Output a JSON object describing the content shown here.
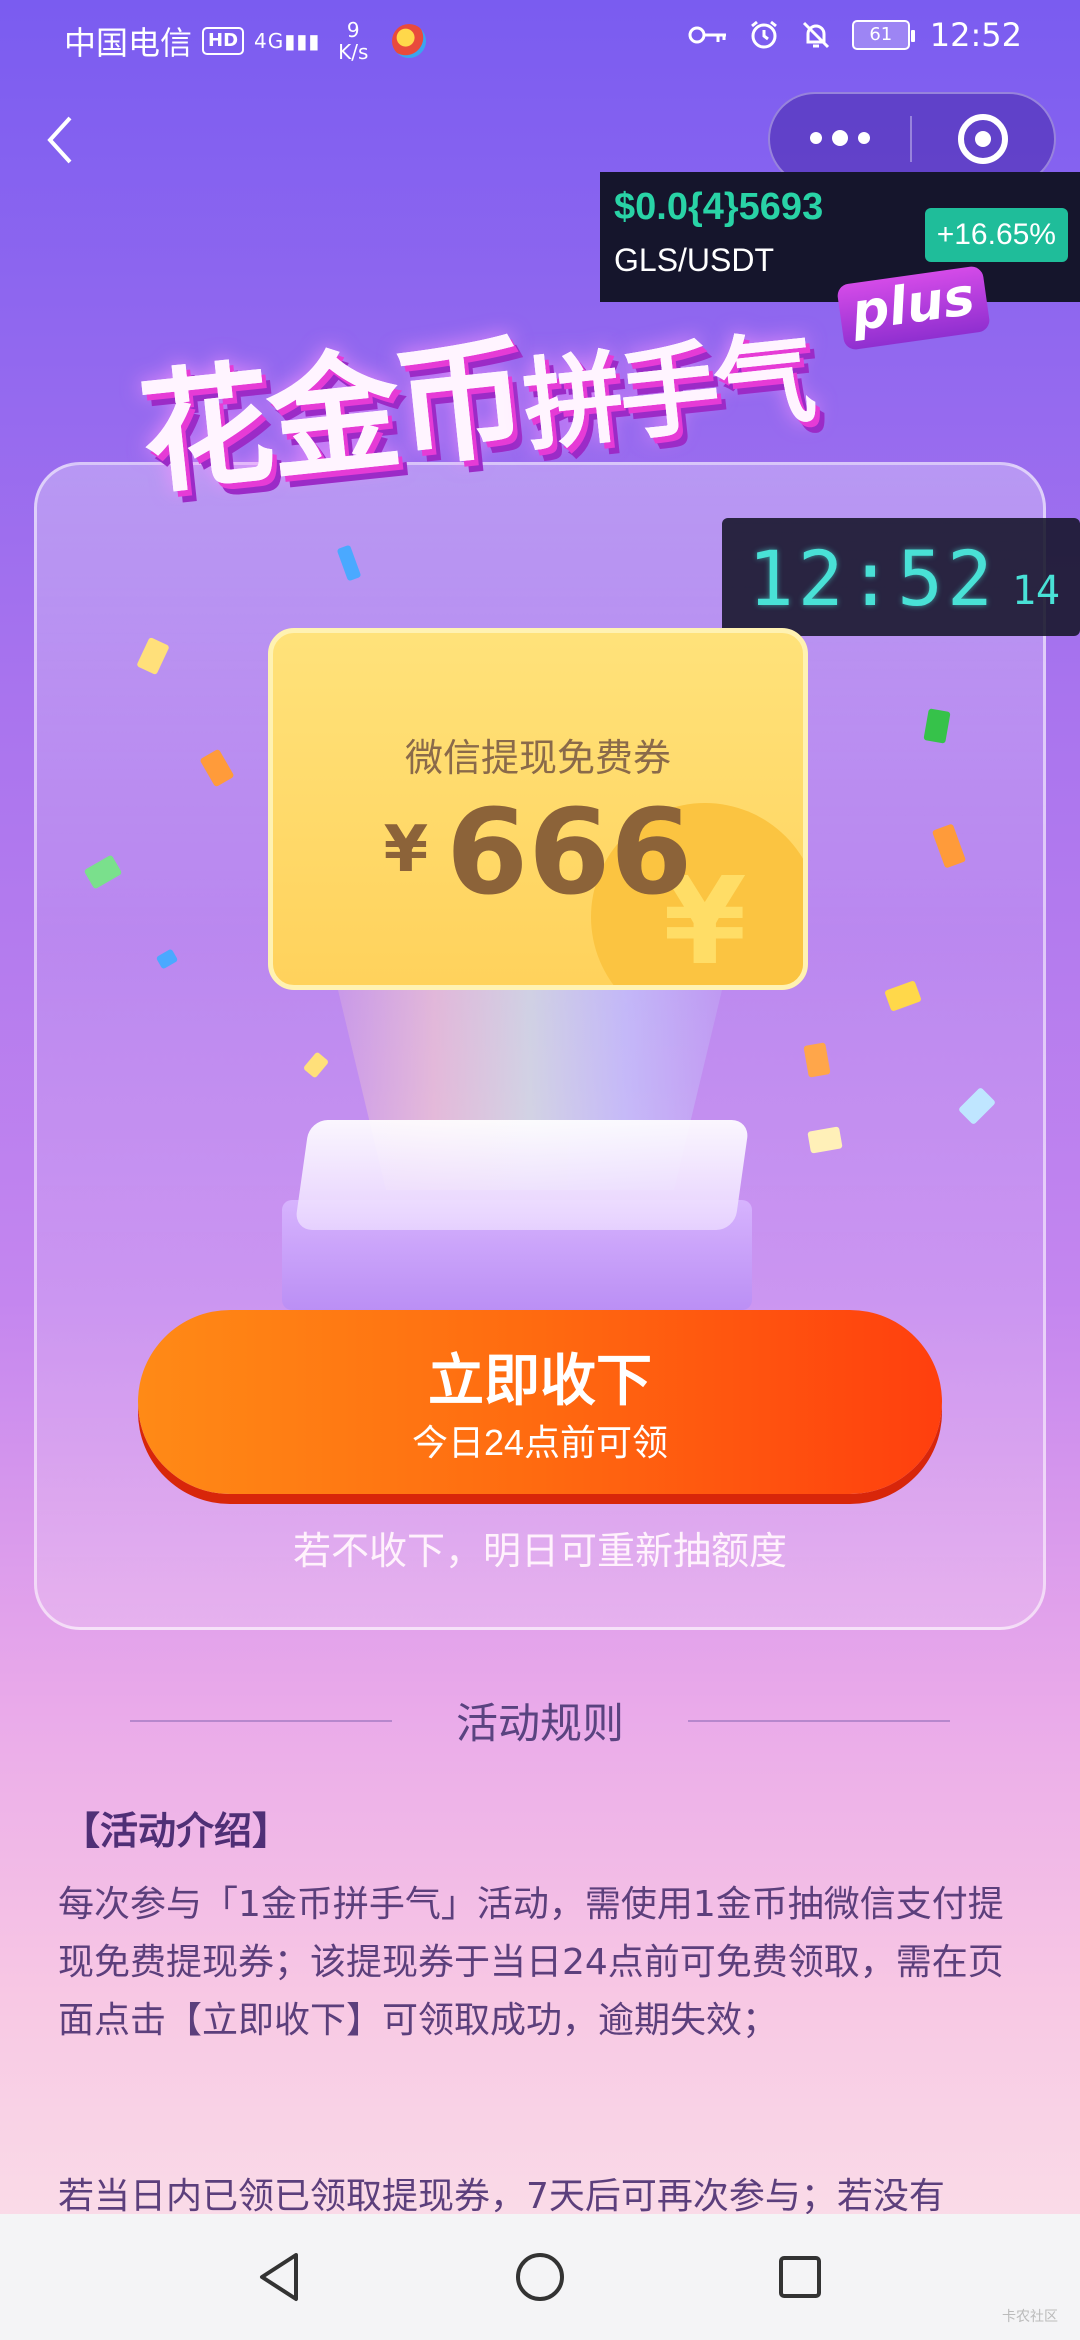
{
  "status_bar": {
    "carrier": "中国电信",
    "hd": "HD",
    "network": "4G",
    "speed_value": "9",
    "speed_unit": "K/s",
    "battery": "61",
    "time": "12:52"
  },
  "nav": {
    "back_icon": "chevron-left-icon",
    "more_icon": "more-dots-icon",
    "close_icon": "target-close-icon"
  },
  "ticker": {
    "price": "$0.0{4}5693",
    "pair": "GLS/USDT",
    "change": "+16.65%",
    "up_color": "#29d3a6"
  },
  "title": {
    "main_big": "花金币",
    "main_small": "拼手气",
    "badge": "plus"
  },
  "clock": {
    "time": "12:52",
    "unit": "14"
  },
  "voucher": {
    "title": "微信提现免费券",
    "currency": "¥",
    "amount": "666",
    "coin_symbol": "¥"
  },
  "cta": {
    "label": "立即收下",
    "sublabel": "今日24点前可领",
    "color": "#ff6a10"
  },
  "hint": "若不收下，明日可重新抽额度",
  "rules": {
    "heading": "活动规则",
    "intro_title": "【活动介绍】",
    "intro_text": "每次参与「1金币拼手气」活动，需使用1金币抽微信支付提现免费提现券；该提现券于当日24点前可免费领取，需在页面点击【立即收下】可领取成功，逾期失效；",
    "intro_text_2": "若当日内已领已领取提现券，7天后可再次参与；若没有"
  },
  "system_nav": {
    "back": "triangle-back-icon",
    "home": "circle-home-icon",
    "recents": "square-recents-icon"
  },
  "watermark": "卡农社区"
}
